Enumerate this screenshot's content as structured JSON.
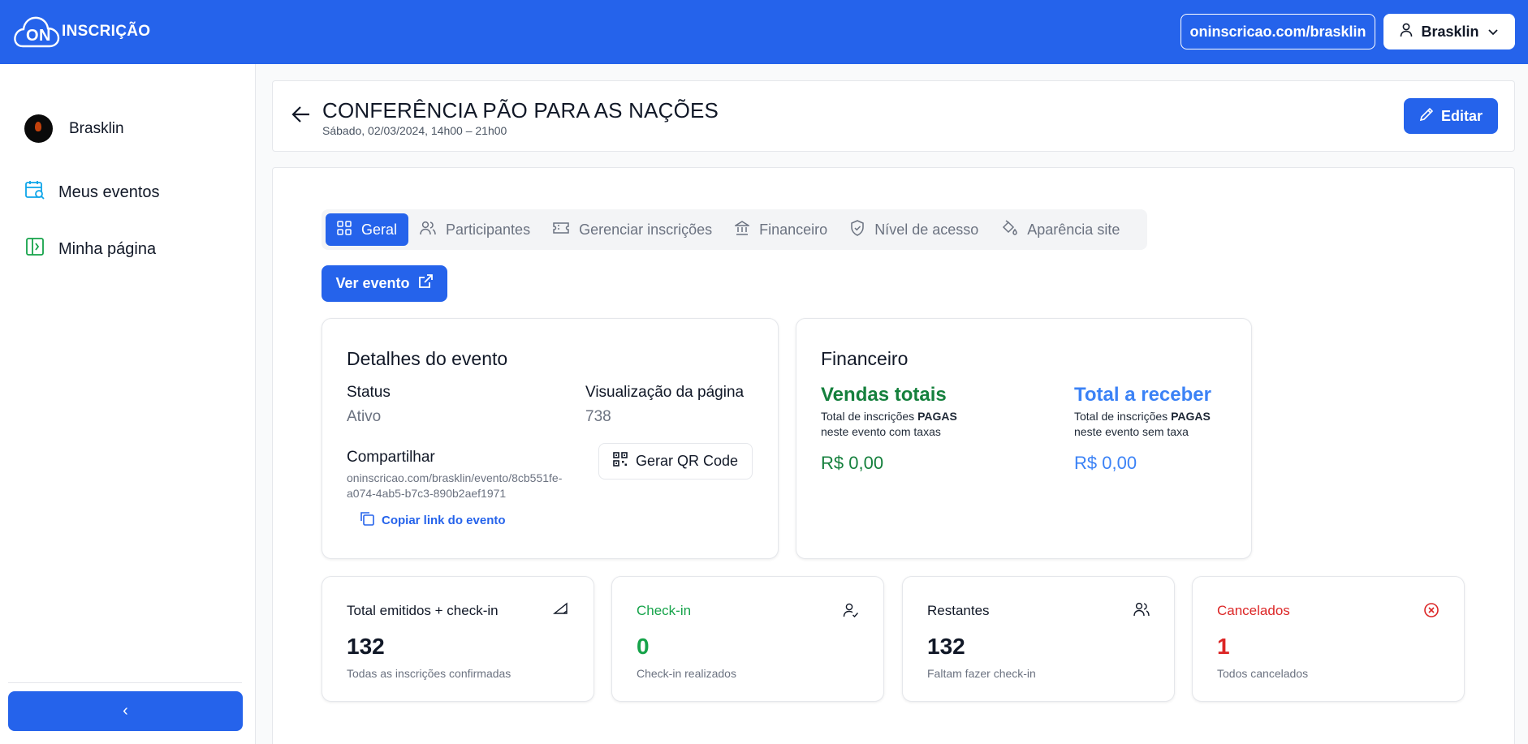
{
  "brand": {
    "logo_on": "ON",
    "logo_text": "INSCRIÇÃO"
  },
  "topbar": {
    "url_button": "oninscricao.com/brasklin",
    "user_button": "Brasklin"
  },
  "sidebar": {
    "user_name": "Brasklin",
    "items": [
      {
        "label": "Meus eventos",
        "icon": "calendar-search-icon"
      },
      {
        "label": "Minha página",
        "icon": "page-layout-icon"
      }
    ],
    "collapse_label": "‹"
  },
  "event": {
    "title": "CONFERÊNCIA PÃO PARA AS NAÇÕES",
    "date": "Sábado, 02/03/2024, 14h00 – 21h00",
    "edit_label": "Editar"
  },
  "tabs": [
    {
      "label": "Geral",
      "icon": "grid-icon",
      "active": true
    },
    {
      "label": "Participantes",
      "icon": "users-icon"
    },
    {
      "label": "Gerenciar inscrições",
      "icon": "ticket-icon"
    },
    {
      "label": "Financeiro",
      "icon": "bank-icon"
    },
    {
      "label": "Nível de acesso",
      "icon": "shield-icon"
    },
    {
      "label": "Aparência site",
      "icon": "paint-bucket-icon"
    }
  ],
  "ver_evento_label": "Ver evento",
  "details": {
    "title": "Detalhes do evento",
    "status_label": "Status",
    "status_value": "Ativo",
    "views_label": "Visualização da página",
    "views_value": "738",
    "share_label": "Compartilhar",
    "share_url": "oninscricao.com/brasklin/evento/8cb551fe-a074-4ab5-b7c3-890b2aef1971",
    "copy_label": "Copiar link do evento",
    "qr_label": "Gerar QR Code"
  },
  "finance": {
    "title": "Financeiro",
    "total_sales": {
      "heading": "Vendas totais",
      "line1_prefix": "Total de inscrições ",
      "line1_bold": "PAGAS",
      "line2": "neste evento com taxas",
      "value": "R$ 0,00",
      "color": "#15803d"
    },
    "to_receive": {
      "heading": "Total a receber",
      "line1_prefix": "Total de inscrições ",
      "line1_bold": "PAGAS",
      "line2": "neste evento sem taxa",
      "value": "R$ 0,00",
      "color": "#3b82f6"
    }
  },
  "stats": [
    {
      "title": "Total emitidos + check-in",
      "value": "132",
      "desc": "Todas as inscrições confirmadas",
      "icon": "tag-icon",
      "color": "#111827"
    },
    {
      "title": "Check-in",
      "value": "0",
      "desc": "Check-in realizados",
      "icon": "user-check-icon",
      "color": "#16a34a"
    },
    {
      "title": "Restantes",
      "value": "132",
      "desc": "Faltam fazer check-in",
      "icon": "users-icon",
      "color": "#111827"
    },
    {
      "title": "Cancelados",
      "value": "1",
      "desc": "Todos cancelados",
      "icon": "x-circle-icon",
      "color": "#dc2626"
    }
  ],
  "colors": {
    "primary": "#2563eb",
    "sidebar_icon": "#0ea5e9",
    "page_icon": "#16a34a"
  }
}
